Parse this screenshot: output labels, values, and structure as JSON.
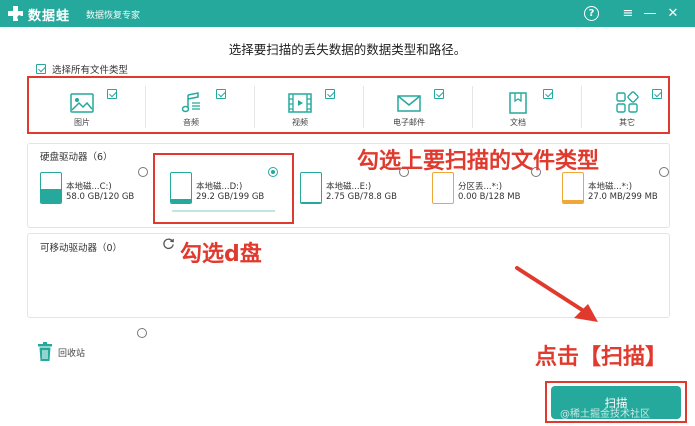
{
  "titlebar": {
    "app_name": "数据蛙",
    "subtitle": "数据恢复专家",
    "help_label": "?",
    "menu_label": "≡",
    "min_label": "—",
    "close_label": "✕"
  },
  "heading": "选择要扫描的丢失数据的数据类型和路径。",
  "select_all": {
    "label": "选择所有文件类型",
    "checked": true
  },
  "file_types": [
    {
      "label": "图片",
      "icon": "image-icon",
      "checked": true
    },
    {
      "label": "音频",
      "icon": "music-note-icon",
      "checked": true
    },
    {
      "label": "视频",
      "icon": "film-icon",
      "checked": true
    },
    {
      "label": "电子邮件",
      "icon": "envelope-icon",
      "checked": true
    },
    {
      "label": "文档",
      "icon": "document-icon",
      "checked": true
    },
    {
      "label": "其它",
      "icon": "grid-shapes-icon",
      "checked": true
    }
  ],
  "hard_drives": {
    "title": "硬盘驱动器（6）",
    "items": [
      {
        "name": "本地磁...C:)",
        "size": "58.0 GB/120 GB",
        "selected": false,
        "used": 0.48,
        "color": "#25a99c"
      },
      {
        "name": "本地磁...D:)",
        "size": "29.2 GB/199 GB",
        "selected": true,
        "used": 0.15,
        "color": "#25a99c"
      },
      {
        "name": "本地磁...E:)",
        "size": "2.75 GB/78.8 GB",
        "selected": false,
        "used": 0.04,
        "color": "#25a99c"
      },
      {
        "name": "分区丢...*:)",
        "size": "0.00  B/128 MB",
        "selected": false,
        "used": 0.0,
        "color": "#f0a73a"
      },
      {
        "name": "本地磁...*:)",
        "size": "27.0 MB/299 MB",
        "selected": false,
        "used": 0.1,
        "color": "#f0a73a"
      }
    ]
  },
  "removable": {
    "title": "可移动驱动器（0）"
  },
  "recycle": {
    "label": "回收站"
  },
  "scan_button": {
    "label": "扫描"
  },
  "annotations": {
    "select_types": "勾选上要扫描的文件类型",
    "select_d": "勾选d盘",
    "click_scan": "点击【扫描】"
  },
  "watermark": "@稀土掘金技术社区",
  "colors": {
    "accent": "#25a99c",
    "annotation": "#e03a2e",
    "warning": "#f0a73a"
  }
}
